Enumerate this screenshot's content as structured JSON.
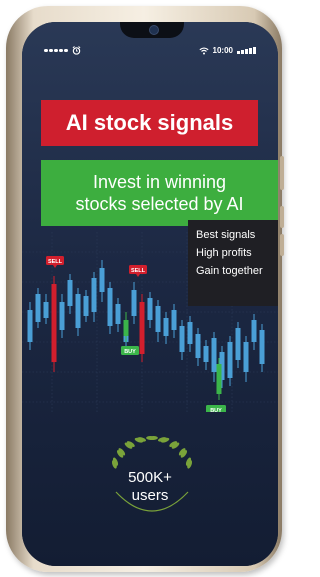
{
  "status_bar": {
    "time": "10:00",
    "icons": [
      "signal-dots-icon",
      "alarm-icon",
      "wifi-icon",
      "battery-icon"
    ]
  },
  "banner": {
    "title": "AI stock signals",
    "subtitle_line1": "Invest in winning",
    "subtitle_line2": "stocks selected by AI",
    "title_color": "#cf1f2e",
    "subtitle_color": "#3dae3f"
  },
  "benefits": [
    "Best signals",
    "High profits",
    "Gain together"
  ],
  "chart": {
    "type": "candlestick",
    "signal_labels": {
      "sell": "SELL",
      "buy": "BUY"
    },
    "colors": {
      "bullish": "#4a9fd6",
      "bearish": "#d21f2d",
      "buy_signal": "#3bb54a",
      "sell_signal": "#d21f2d"
    }
  },
  "badge": {
    "count": "500K+",
    "label": "users",
    "laurel_color": "#7aa33a"
  }
}
